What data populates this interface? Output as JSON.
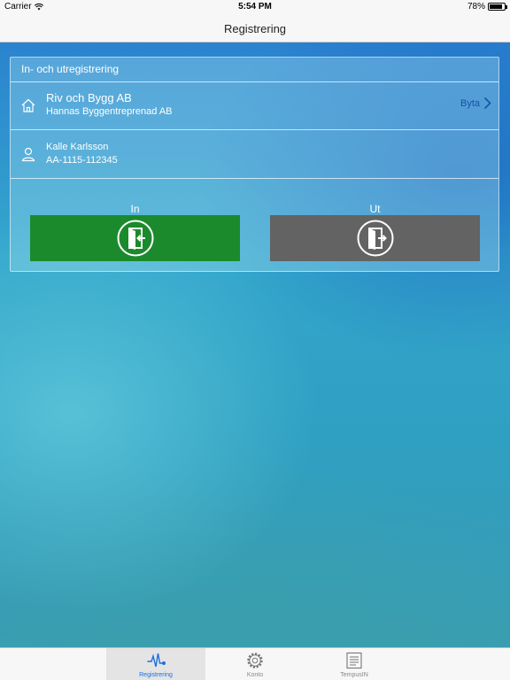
{
  "status": {
    "carrier": "Carrier",
    "time": "5:54 PM",
    "battery": "78%"
  },
  "nav": {
    "title": "Registrering"
  },
  "card": {
    "header": "In- och utregistrering",
    "company": {
      "name": "Riv och Bygg AB",
      "sub": "Hannas Byggentreprenad AB",
      "change_label": "Byta"
    },
    "person": {
      "name": "Kalle Karlsson",
      "id": "AA-1115-112345"
    },
    "in_label": "In",
    "out_label": "Ut"
  },
  "colors": {
    "in_button": "#1b8a2c",
    "out_button": "#636363",
    "tab_active": "#1d6fe0",
    "link": "#1453a8"
  },
  "tabs": [
    {
      "label": "Registrering",
      "icon": "pulse-icon",
      "active": true
    },
    {
      "label": "Konto",
      "icon": "gear-icon",
      "active": false
    },
    {
      "label": "TempusIN",
      "icon": "list-icon",
      "active": false
    }
  ]
}
